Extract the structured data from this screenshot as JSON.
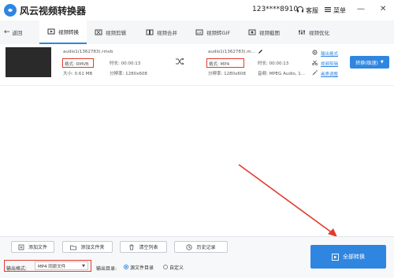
{
  "app": {
    "title": "风云视频转换器",
    "phone": "123****8910",
    "support": "客服",
    "menu": "菜单",
    "minimize": "—",
    "close": "✕"
  },
  "tabs": {
    "back": "返回",
    "items": [
      {
        "label": "视频转换",
        "active": true
      },
      {
        "label": "视频剪辑",
        "active": false
      },
      {
        "label": "视频合并",
        "active": false
      },
      {
        "label": "视频转GIF",
        "active": false
      },
      {
        "label": "视频截图",
        "active": false
      },
      {
        "label": "视频优化",
        "active": false
      }
    ]
  },
  "file": {
    "source": {
      "name": "audio1(1362783).rmvb",
      "format": "格式: RMVB",
      "duration": "时长: 00:00:13",
      "size": "大小: 0.61 MB",
      "resolution": "分辨率: 1280x608"
    },
    "target": {
      "name": "audio1(1362783).m...",
      "format": "格式: MP4",
      "duration": "时长: 00:00:13",
      "resolution": "分辨率: 1280x608",
      "audio": "音频: MPEG Audio, 1..."
    },
    "actions": {
      "output_format": "输出格式",
      "edit_video": "视频剪辑",
      "effects": "画质调整"
    },
    "convert_button": "转换(极速)"
  },
  "bottom": {
    "add_file": "添加文件",
    "add_folder": "添加文件夹",
    "clear_list": "清空列表",
    "history": "历史记录",
    "output_format_label": "输出格式:",
    "output_format_value": "MP4 同原文件",
    "output_dir_label": "输出目录:",
    "dir_source": "源文件目录",
    "dir_custom": "自定义",
    "convert_all": "全部转换"
  },
  "colors": {
    "accent": "#2f86e0",
    "highlight": "#e23a2e"
  }
}
